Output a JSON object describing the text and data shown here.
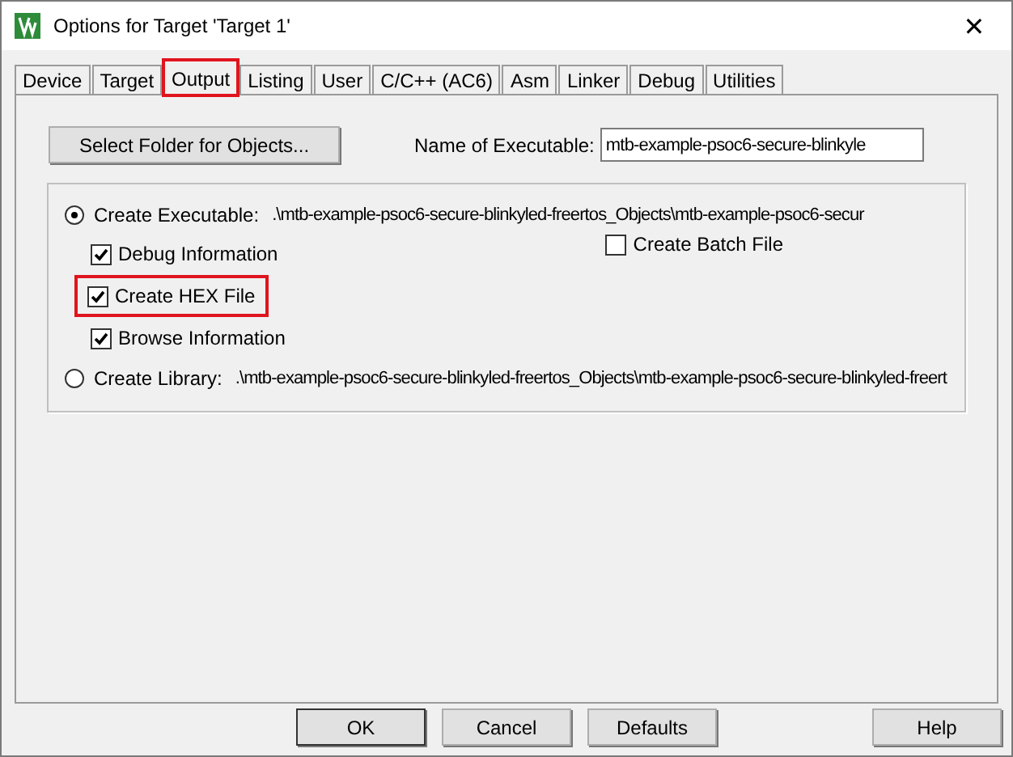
{
  "window": {
    "title": "Options for Target 'Target 1'",
    "close": "✕"
  },
  "tabs": [
    {
      "label": "Device",
      "selected": false,
      "highlighted": false
    },
    {
      "label": "Target",
      "selected": false,
      "highlighted": false
    },
    {
      "label": "Output",
      "selected": true,
      "highlighted": true
    },
    {
      "label": "Listing",
      "selected": false,
      "highlighted": false
    },
    {
      "label": "User",
      "selected": false,
      "highlighted": false
    },
    {
      "label": "C/C++ (AC6)",
      "selected": false,
      "highlighted": false
    },
    {
      "label": "Asm",
      "selected": false,
      "highlighted": false
    },
    {
      "label": "Linker",
      "selected": false,
      "highlighted": false
    },
    {
      "label": "Debug",
      "selected": false,
      "highlighted": false
    },
    {
      "label": "Utilities",
      "selected": false,
      "highlighted": false
    }
  ],
  "select_folder_button": "Select Folder for Objects...",
  "executable_name": {
    "label": "Name of Executable:",
    "value": "mtb-example-psoc6-secure-blinkyle"
  },
  "create_executable": {
    "label": "Create Executable:",
    "path": ".\\mtb-example-psoc6-secure-blinkyled-freertos_Objects\\mtb-example-psoc6-secur",
    "selected": true
  },
  "options": [
    {
      "label": "Debug Information",
      "checked": true,
      "highlighted": false
    },
    {
      "label": "Create HEX File",
      "checked": true,
      "highlighted": true
    },
    {
      "label": "Browse Information",
      "checked": true,
      "highlighted": false
    }
  ],
  "create_batch_file": {
    "label": "Create Batch File",
    "checked": false
  },
  "create_library": {
    "label": "Create Library:",
    "path": ".\\mtb-example-psoc6-secure-blinkyled-freertos_Objects\\mtb-example-psoc6-secure-blinkyled-freert",
    "selected": false
  },
  "buttons": [
    {
      "label": "OK",
      "kind": "default"
    },
    {
      "label": "Cancel",
      "kind": "normal"
    },
    {
      "label": "Defaults",
      "kind": "normal"
    },
    {
      "label": "Help",
      "kind": "help"
    }
  ]
}
